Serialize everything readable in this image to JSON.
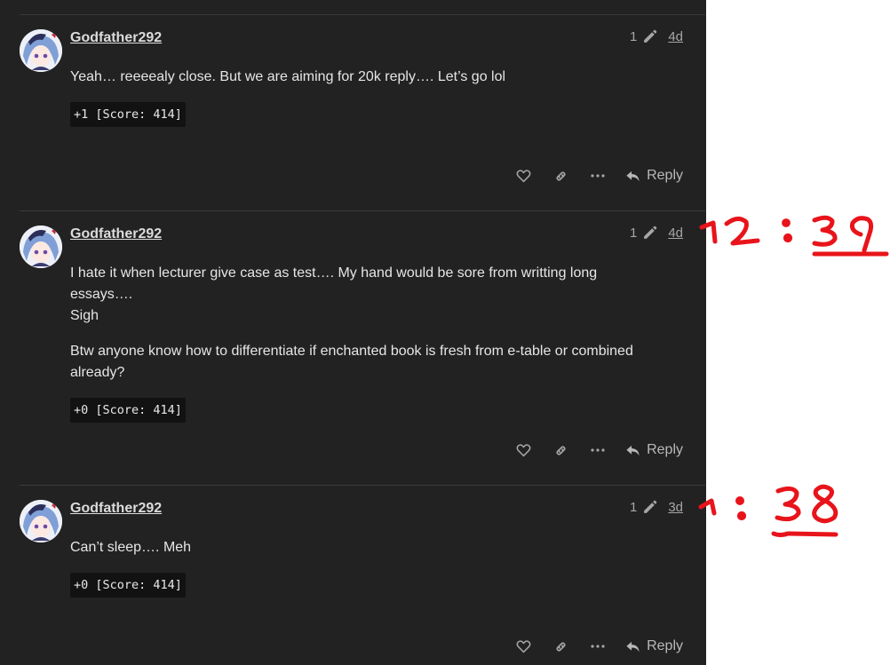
{
  "posts": [
    {
      "username": "Godfather292",
      "edit_count": "1",
      "date": "4d",
      "paragraphs": [
        "Yeah… reeeealy close. But we are aiming for 20k reply…. Let’s go lol"
      ],
      "score": "+1 [Score: 414]",
      "reply_label": "Reply"
    },
    {
      "username": "Godfather292",
      "edit_count": "1",
      "date": "4d",
      "paragraphs": [
        "I hate it when lecturer give case as test…. My hand would be sore from writting long essays….",
        "Sigh",
        "Btw anyone know how to differentiate if enchanted book is fresh from e-table or combined already?"
      ],
      "score": "+0 [Score: 414]",
      "reply_label": "Reply"
    },
    {
      "username": "Godfather292",
      "edit_count": "1",
      "date": "3d",
      "paragraphs": [
        "Can’t sleep…. Meh"
      ],
      "score": "+0 [Score: 414]",
      "reply_label": "Reply"
    }
  ],
  "annotations": [
    "12 : 39",
    "1 : 38"
  ],
  "colors": {
    "feed_background": "#222222",
    "annotation_red": "#e8141b",
    "text": "#e6e6e6",
    "muted": "#a6a6a6"
  },
  "icons": [
    "avatar",
    "pencil-icon",
    "heart-icon",
    "link-icon",
    "more-icon",
    "reply-icon"
  ]
}
